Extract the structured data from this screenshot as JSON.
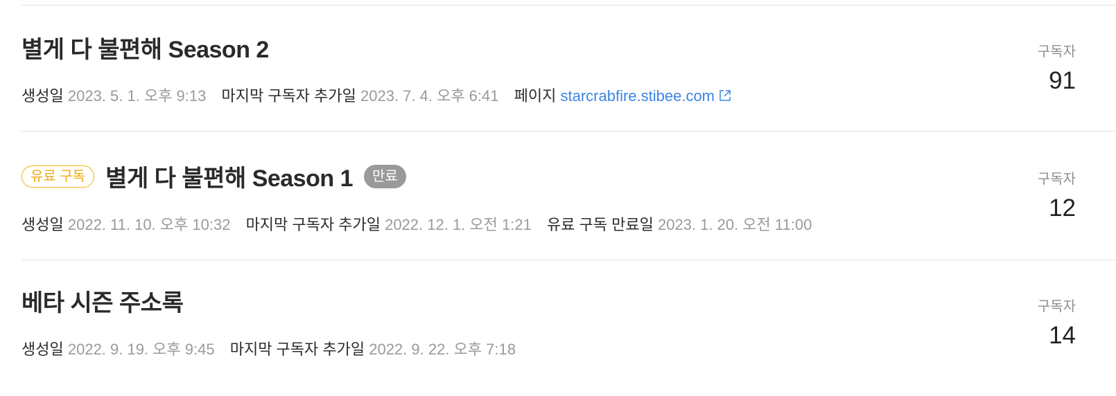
{
  "rows": [
    {
      "title": "별게 다 불편해 Season 2",
      "meta": {
        "created_label": "생성일",
        "created_value": "2023. 5. 1. 오후 9:13",
        "last_added_label": "마지막 구독자 추가일",
        "last_added_value": "2023. 7. 4. 오후 6:41",
        "page_label": "페이지",
        "page_link": "starcrabfire.stibee.com"
      },
      "subscribers_label": "구독자",
      "subscribers_count": "91"
    },
    {
      "paid_badge": "유료 구독",
      "title": "별게 다 불편해 Season 1",
      "expired_badge": "만료",
      "meta": {
        "created_label": "생성일",
        "created_value": "2022. 11. 10. 오후 10:32",
        "last_added_label": "마지막 구독자 추가일",
        "last_added_value": "2022. 12. 1. 오전 1:21",
        "paid_expiry_label": "유료 구독 만료일",
        "paid_expiry_value": "2023. 1. 20. 오전 11:00"
      },
      "subscribers_label": "구독자",
      "subscribers_count": "12"
    },
    {
      "title": "베타 시즌 주소록",
      "meta": {
        "created_label": "생성일",
        "created_value": "2022. 9. 19. 오후 9:45",
        "last_added_label": "마지막 구독자 추가일",
        "last_added_value": "2022. 9. 22. 오후 7:18"
      },
      "subscribers_label": "구독자",
      "subscribers_count": "14"
    }
  ],
  "colors": {
    "paid_badge": "#f0a90f",
    "expired_badge_bg": "#9a9a9a",
    "link": "#3b84e5",
    "meta_value": "#9a9a9a",
    "divider": "#e2e2e2"
  },
  "icons": {
    "external_link": "external-link-icon"
  }
}
